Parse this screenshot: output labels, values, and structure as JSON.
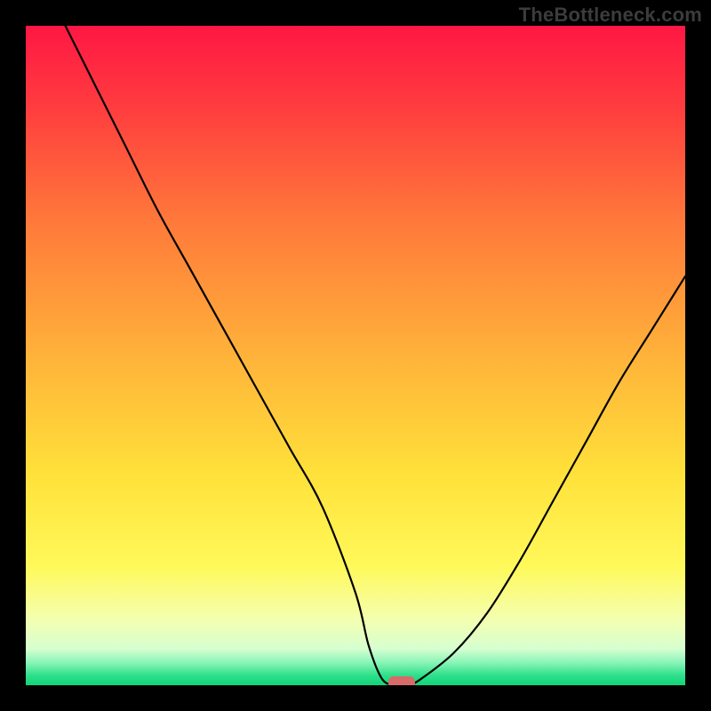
{
  "watermark": "TheBottleneck.com",
  "chart_data": {
    "type": "line",
    "title": "",
    "xlabel": "",
    "ylabel": "",
    "xlim": [
      0,
      100
    ],
    "ylim": [
      0,
      100
    ],
    "series": [
      {
        "name": "bottleneck-curve",
        "x": [
          6,
          10,
          15,
          20,
          25,
          30,
          35,
          40,
          45,
          50,
          52,
          54,
          56,
          58,
          60,
          65,
          70,
          75,
          80,
          85,
          90,
          95,
          100
        ],
        "y": [
          100,
          92,
          82,
          72,
          63,
          54,
          45,
          36,
          27,
          14,
          6,
          1,
          0,
          0,
          1,
          5,
          11,
          19,
          28,
          37,
          46,
          54,
          62
        ]
      }
    ],
    "marker": {
      "x": 57,
      "y": 0,
      "color": "#d96a6a"
    },
    "gradient_stops": [
      {
        "offset": 0.0,
        "color": "#ff1744"
      },
      {
        "offset": 0.12,
        "color": "#ff3b3f"
      },
      {
        "offset": 0.3,
        "color": "#ff7a3a"
      },
      {
        "offset": 0.5,
        "color": "#ffb23a"
      },
      {
        "offset": 0.68,
        "color": "#ffe13a"
      },
      {
        "offset": 0.82,
        "color": "#fff95a"
      },
      {
        "offset": 0.9,
        "color": "#f4ffb0"
      },
      {
        "offset": 0.945,
        "color": "#d6ffd0"
      },
      {
        "offset": 0.965,
        "color": "#8cf5b8"
      },
      {
        "offset": 0.985,
        "color": "#2ee08a"
      },
      {
        "offset": 1.0,
        "color": "#10d477"
      }
    ]
  }
}
